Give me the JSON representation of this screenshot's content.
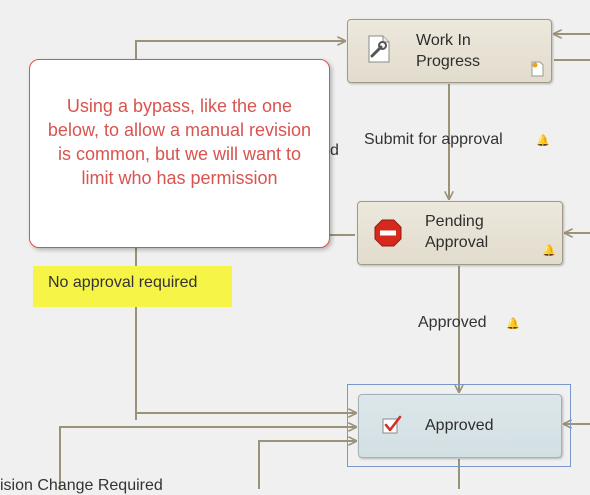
{
  "nodes": {
    "wip": {
      "line1": "Work In",
      "line2": "Progress",
      "icon": "wrench-page-icon"
    },
    "pending": {
      "line1": "Pending",
      "line2": "Approval",
      "icon": "stop-sign-icon"
    },
    "approved": {
      "label": "Approved",
      "icon": "checkbox-checked-icon"
    }
  },
  "edge_labels": {
    "submit": "Submit for approval",
    "approved": "Approved",
    "revision": "ision Change Required",
    "partial_d": "d"
  },
  "callout": {
    "text": "Using a bypass, like the one below, to allow a manual revision is common, but we will want to limit who has permission"
  },
  "note": {
    "text": "No approval required"
  },
  "colors": {
    "connector": "#9a9378",
    "callout_border": "#d9534f",
    "note_background": "#f6f446",
    "bell": "#e0a400"
  }
}
